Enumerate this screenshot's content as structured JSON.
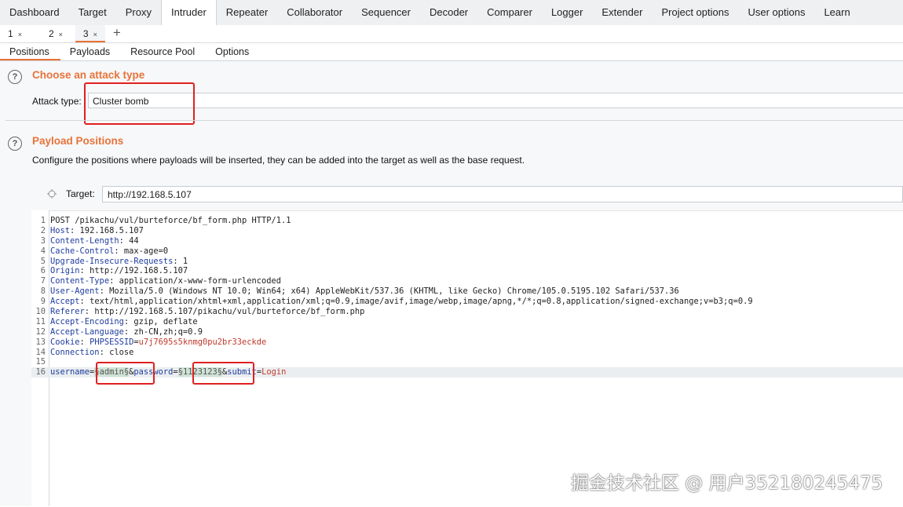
{
  "top_tabs": [
    "Dashboard",
    "Target",
    "Proxy",
    "Intruder",
    "Repeater",
    "Collaborator",
    "Sequencer",
    "Decoder",
    "Comparer",
    "Logger",
    "Extender",
    "Project options",
    "User options",
    "Learn"
  ],
  "attack_tabs": [
    {
      "label": "1",
      "close": "×"
    },
    {
      "label": "2",
      "close": "×"
    },
    {
      "label": "3",
      "close": "×"
    }
  ],
  "add_tab": "+",
  "sub_tabs": [
    "Positions",
    "Payloads",
    "Resource Pool",
    "Options"
  ],
  "attack_type": {
    "title": "Choose an attack type",
    "label": "Attack type:",
    "value": "Cluster bomb"
  },
  "payload_positions": {
    "title": "Payload Positions",
    "description": "Configure the positions where payloads will be inserted, they can be added into the target as well as the base request.",
    "target_label": "Target:",
    "target_value": "http://192.168.5.107"
  },
  "help_glyph": "?",
  "request": {
    "line1": "POST /pikachu/vul/burteforce/bf_form.php HTTP/1.1",
    "headers": [
      {
        "name": "Host",
        "value": " 192.168.5.107"
      },
      {
        "name": "Content-Length",
        "value": " 44"
      },
      {
        "name": "Cache-Control",
        "value": " max-age=0"
      },
      {
        "name": "Upgrade-Insecure-Requests",
        "value": " 1"
      },
      {
        "name": "Origin",
        "value": " http://192.168.5.107"
      },
      {
        "name": "Content-Type",
        "value": " application/x-www-form-urlencoded"
      },
      {
        "name": "User-Agent",
        "value": " Mozilla/5.0 (Windows NT 10.0; Win64; x64) AppleWebKit/537.36 (KHTML, like Gecko) Chrome/105.0.5195.102 Safari/537.36"
      },
      {
        "name": "Accept",
        "value": " text/html,application/xhtml+xml,application/xml;q=0.9,image/avif,image/webp,image/apng,*/*;q=0.8,application/signed-exchange;v=b3;q=0.9"
      },
      {
        "name": "Referer",
        "value": " http://192.168.5.107/pikachu/vul/burteforce/bf_form.php"
      },
      {
        "name": "Accept-Encoding",
        "value": " gzip, deflate"
      },
      {
        "name": "Accept-Language",
        "value": " zh-CN,zh;q=0.9"
      }
    ],
    "cookie_name": "Cookie",
    "cookie_key": " PHPSESSID",
    "cookie_eq": "=",
    "cookie_val": "u7j7695s5knmg0pu2br33eckde",
    "connection_name": "Connection",
    "connection_value": " close",
    "body": {
      "k1": "username",
      "eq1": "=",
      "p1": "§admin§",
      "amp1": "&",
      "k2": "password",
      "eq2": "=",
      "p2": "§1123123§",
      "amp2": "&",
      "k3": "submit",
      "eq3": "=",
      "v3": "Login"
    },
    "sep": ":",
    "line_numbers": [
      "1",
      "2",
      "3",
      "4",
      "5",
      "6",
      "7",
      "8",
      "9",
      "10",
      "11",
      "12",
      "13",
      "14",
      "15",
      "16"
    ]
  },
  "watermark": "掘金技术社区 @ 用户352180245475",
  "colors": {
    "accent": "#e8733a",
    "highlight": "#e02020",
    "header_name": "#1f3c9e"
  }
}
